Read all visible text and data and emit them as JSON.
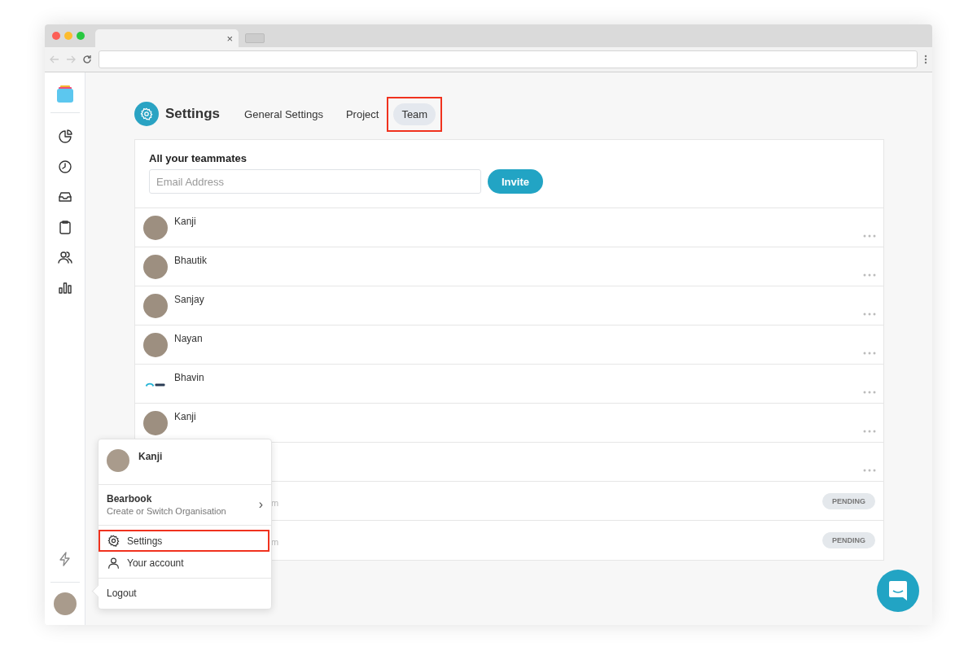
{
  "browser": {
    "tab_close": "×"
  },
  "header": {
    "title": "Settings",
    "tabs": [
      {
        "label": "General Settings",
        "selected": false,
        "highlighted": false
      },
      {
        "label": "Project",
        "selected": false,
        "highlighted": false
      },
      {
        "label": "Team",
        "selected": true,
        "highlighted": true
      }
    ]
  },
  "team": {
    "heading": "All your teammates",
    "email_placeholder": "Email Address",
    "invite_button": "Invite",
    "rows": [
      {
        "kind": "photo",
        "name": "Kanji"
      },
      {
        "kind": "photo",
        "name": "Bhautik"
      },
      {
        "kind": "photo",
        "name": "Sanjay"
      },
      {
        "kind": "photo",
        "name": "Nayan"
      },
      {
        "kind": "logo",
        "name": "Bhavin"
      },
      {
        "kind": "photo",
        "name": "Kanji"
      },
      {
        "kind": "covered"
      },
      {
        "kind": "pending",
        "email": "m",
        "status": "PENDING"
      },
      {
        "kind": "pending",
        "email": "m",
        "status": "PENDING"
      }
    ]
  },
  "account_menu": {
    "user_name": "Kanji",
    "org_name": "Bearbook",
    "org_hint": "Create or Switch Organisation",
    "chevron": "›",
    "items": [
      {
        "label": "Settings",
        "highlighted": true
      },
      {
        "label": "Your account",
        "highlighted": false
      }
    ],
    "logout": "Logout"
  }
}
